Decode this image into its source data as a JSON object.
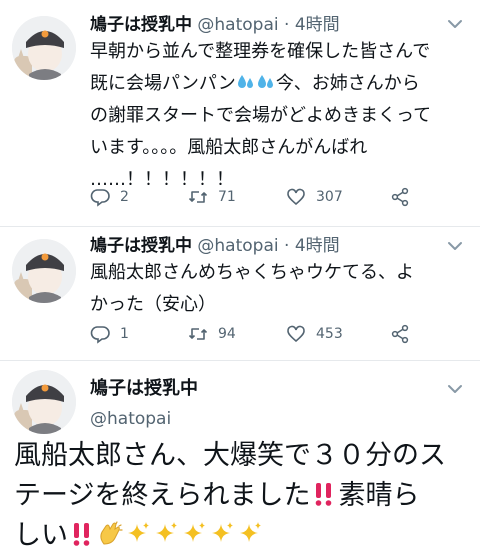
{
  "tweets": [
    {
      "name": "鳩子は授乳中",
      "handle": "@hatopai",
      "separator": "·",
      "time": "4時間",
      "text_lines": [
        "早朝から並んで整理券を確保した皆さんで",
        "既に会場パンパン",
        "今、お姉さんから",
        "の謝罪スタートで会場がどよめきまくって",
        "います。。。。風船太郎さんがんばれ",
        "……！！！！！！"
      ],
      "reply_count": "2",
      "retweet_count": "71",
      "like_count": "307"
    },
    {
      "name": "鳩子は授乳中",
      "handle": "@hatopai",
      "separator": "·",
      "time": "4時間",
      "text_lines": [
        "風船太郎さんめちゃくちゃウケてる、よ",
        "かった（安心）"
      ],
      "reply_count": "1",
      "retweet_count": "94",
      "like_count": "453"
    }
  ],
  "focused": {
    "name": "鳩子は授乳中",
    "handle": "@hatopai",
    "line1": "風船太郎さん、大爆笑で３０分のス",
    "line2a": "テージを終えられました",
    "line2b": "素晴ら",
    "line3": "しい"
  },
  "icons": {
    "reply": "reply-icon",
    "retweet": "retweet-icon",
    "like": "heart-icon",
    "share": "share-icon",
    "more": "chevron-down-icon",
    "sweat": "sweat-droplets-emoji",
    "exclaim": "double-exclamation-emoji",
    "clap": "clapping-hands-emoji",
    "sparkles": "sparkles-emoji"
  },
  "colors": {
    "text": "#0f1419",
    "muted": "#536471",
    "divider": "#e6e9ec",
    "exclaim": "#e0245e",
    "sweat": "#4fb3e8",
    "sparkle": "#f4c022",
    "clap": "#f7c847"
  }
}
